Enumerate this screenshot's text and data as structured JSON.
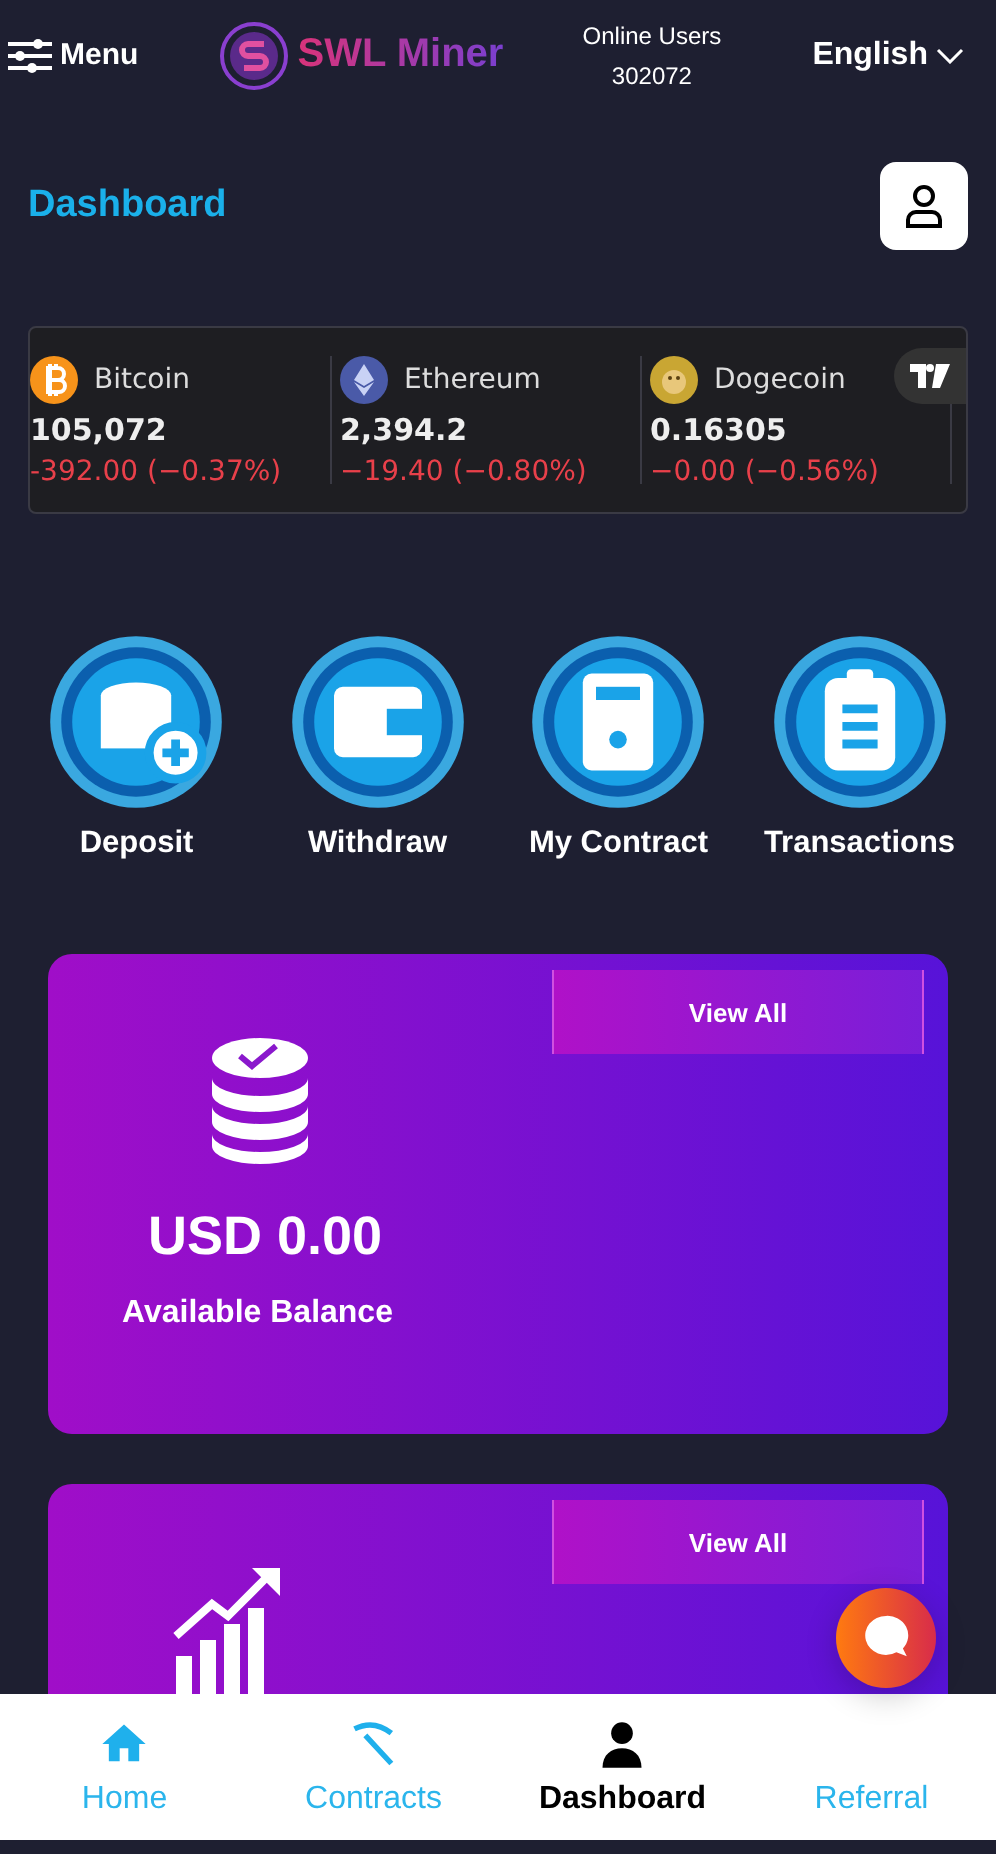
{
  "header": {
    "menu_label": "Menu",
    "logo_text": "SWL Miner",
    "online_label": "Online Users",
    "online_count": "302072",
    "language": "English"
  },
  "page_title": "Dashboard",
  "ticker": [
    {
      "kind": "btc",
      "name": "Bitcoin",
      "price": "105,072",
      "change": "-392.00 (−0.37%)"
    },
    {
      "kind": "eth",
      "name": "Ethereum",
      "price": "2,394.2",
      "change": "−19.40 (−0.80%)"
    },
    {
      "kind": "doge",
      "name": "Dogecoin",
      "price": "0.16305",
      "change": "−0.00 (−0.56%)"
    }
  ],
  "actions": [
    {
      "kind": "deposit",
      "label": "Deposit"
    },
    {
      "kind": "withdraw",
      "label": "Withdraw"
    },
    {
      "kind": "contract",
      "label": "My Contract"
    },
    {
      "kind": "transactions",
      "label": "Transactions"
    }
  ],
  "cards": [
    {
      "kind": "balance",
      "button": "View All",
      "amount": "USD 0.00",
      "caption": "Available Balance"
    },
    {
      "kind": "growth",
      "button": "View All"
    }
  ],
  "nav": [
    {
      "kind": "home",
      "label": "Home",
      "selected": false
    },
    {
      "kind": "contracts",
      "label": "Contracts",
      "selected": false
    },
    {
      "kind": "dashboard",
      "label": "Dashboard",
      "selected": true
    },
    {
      "kind": "referral",
      "label": "Referral",
      "selected": false
    }
  ]
}
